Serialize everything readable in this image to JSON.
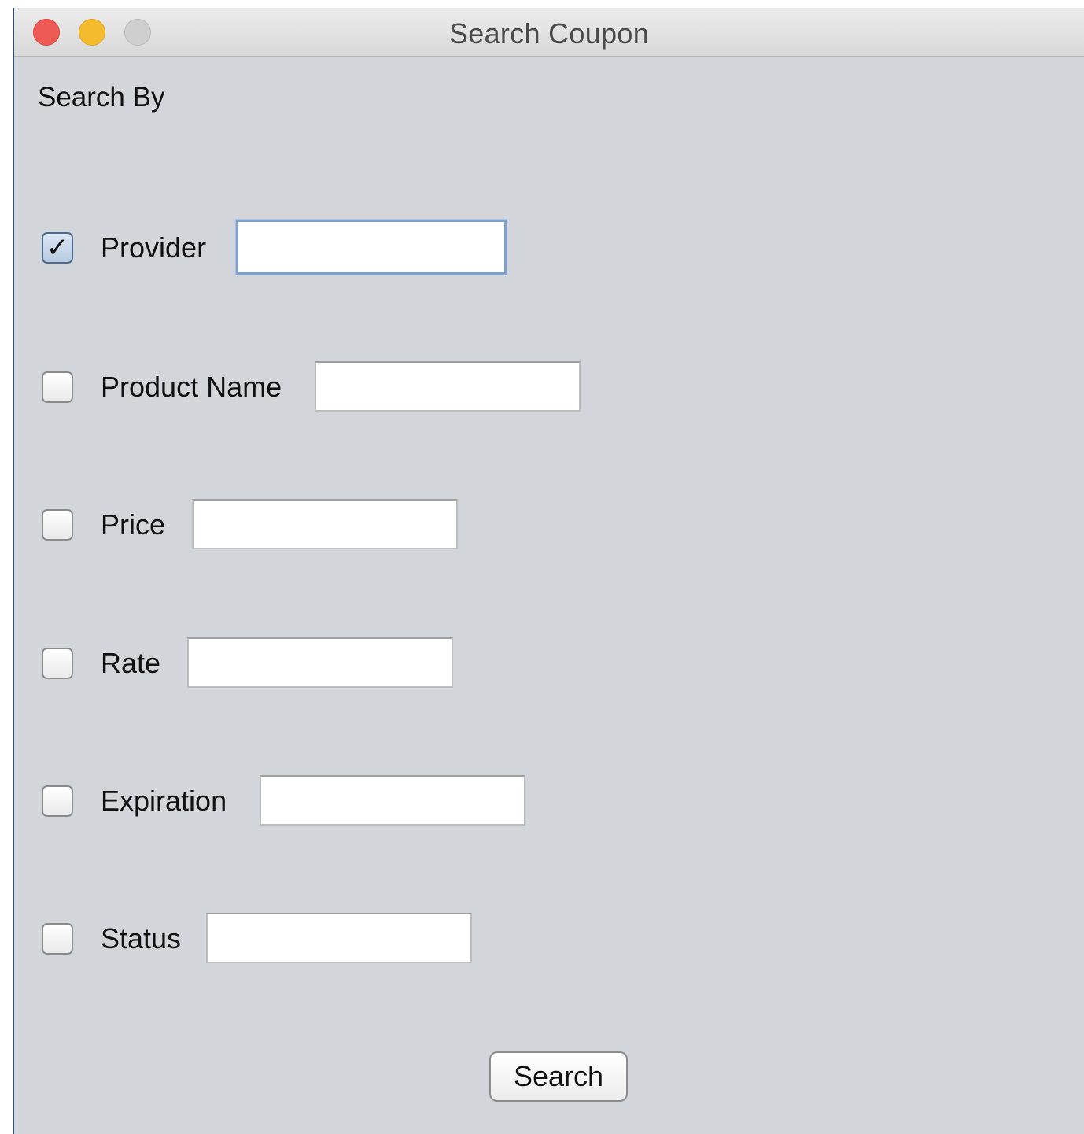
{
  "window": {
    "title": "Search Coupon"
  },
  "form": {
    "section_label": "Search By",
    "fields": [
      {
        "label": "Provider",
        "checked": true,
        "value": ""
      },
      {
        "label": "Product Name",
        "checked": false,
        "value": ""
      },
      {
        "label": "Price",
        "checked": false,
        "value": ""
      },
      {
        "label": "Rate",
        "checked": false,
        "value": ""
      },
      {
        "label": "Expiration",
        "checked": false,
        "value": ""
      },
      {
        "label": "Status",
        "checked": false,
        "value": ""
      }
    ],
    "search_label": "Search"
  },
  "colors": {
    "window_bg": "#d2d6db",
    "close": "#ee5b55",
    "minimize": "#f5bb2f",
    "zoom": "#cfcfcf",
    "focus_ring": "#7ea0cf"
  }
}
